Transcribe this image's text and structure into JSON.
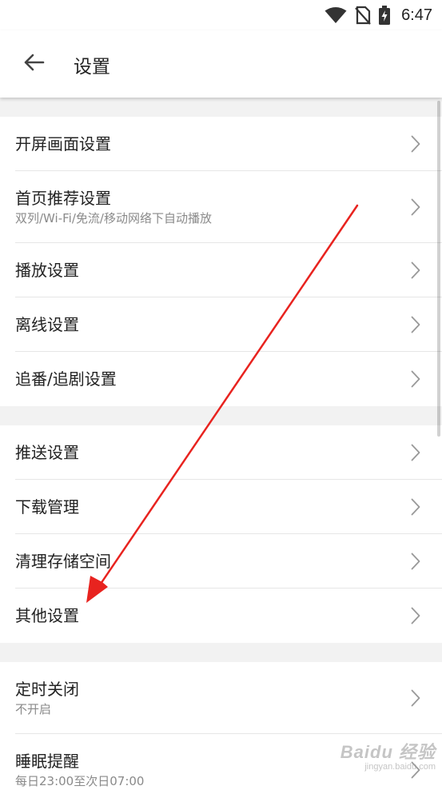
{
  "status_bar": {
    "time": "6:47",
    "icons": [
      "wifi-icon",
      "no-sim-icon",
      "battery-charging-icon"
    ]
  },
  "header": {
    "back_icon": "arrow-left-icon",
    "title": "设置"
  },
  "groups": [
    {
      "items": [
        {
          "title": "开屏画面设置",
          "subtitle": ""
        },
        {
          "title": "首页推荐设置",
          "subtitle": "双列/Wi-Fi/免流/移动网络下自动播放"
        },
        {
          "title": "播放设置",
          "subtitle": ""
        },
        {
          "title": "离线设置",
          "subtitle": ""
        },
        {
          "title": "追番/追剧设置",
          "subtitle": ""
        }
      ]
    },
    {
      "items": [
        {
          "title": "推送设置",
          "subtitle": ""
        },
        {
          "title": "下载管理",
          "subtitle": ""
        },
        {
          "title": "清理存储空间",
          "subtitle": ""
        },
        {
          "title": "其他设置",
          "subtitle": ""
        }
      ]
    },
    {
      "items": [
        {
          "title": "定时关闭",
          "subtitle": "不开启"
        },
        {
          "title": "睡眠提醒",
          "subtitle": "每日23:00至次日07:00"
        }
      ]
    }
  ],
  "colors": {
    "annotation_arrow": "#e8231f",
    "divider": "#e6e6e6",
    "background": "#f2f2f2"
  },
  "watermark": {
    "main": "Baidu 经验",
    "sub": "jingyan.baidu.com"
  }
}
